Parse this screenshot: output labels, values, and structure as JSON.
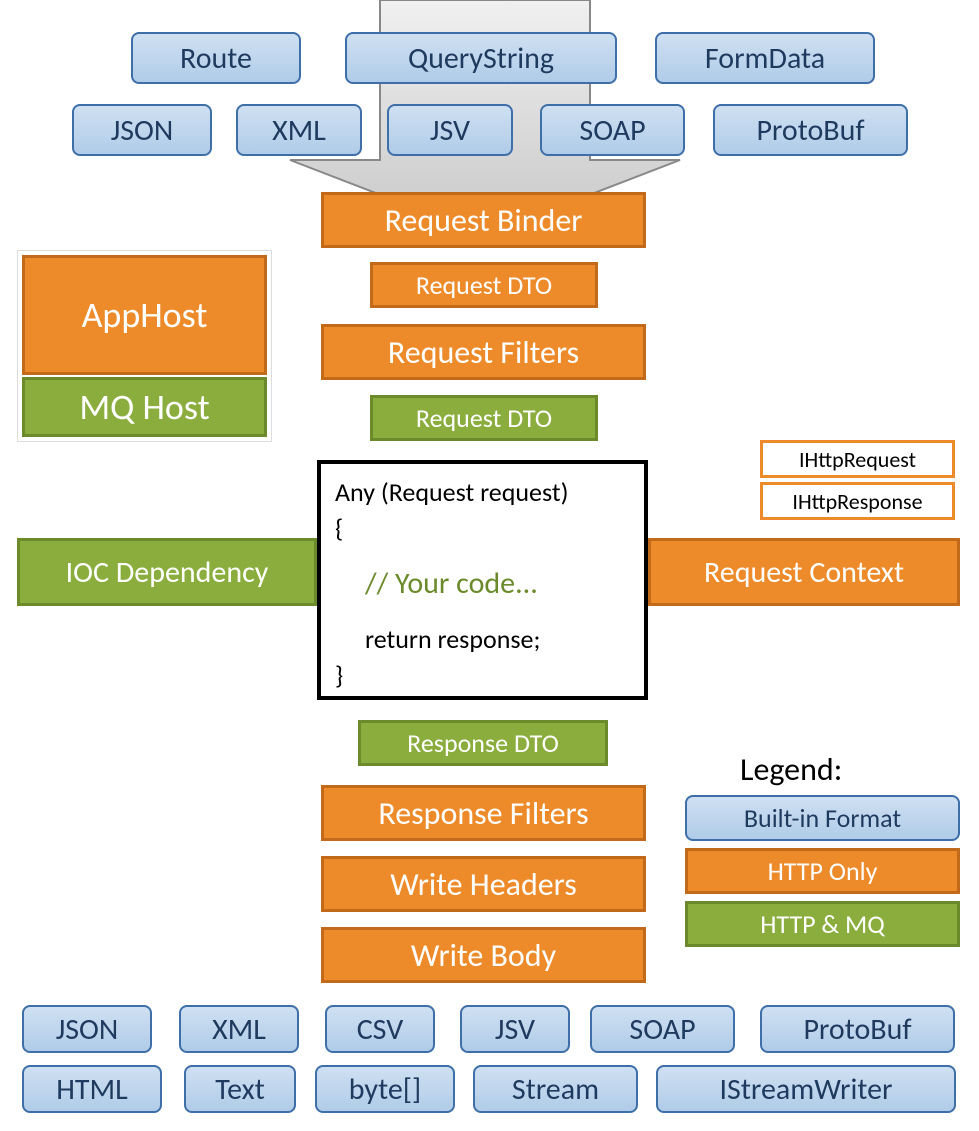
{
  "top_inputs_row1": {
    "route": "Route",
    "querystring": "QueryString",
    "formdata": "FormData"
  },
  "top_inputs_row2": {
    "json": "JSON",
    "xml": "XML",
    "jsv": "JSV",
    "soap": "SOAP",
    "protobuf": "ProtoBuf"
  },
  "pipeline": {
    "request_binder": "Request Binder",
    "request_dto_1": "Request DTO",
    "request_filters": "Request Filters",
    "request_dto_2": "Request DTO",
    "response_dto": "Response DTO",
    "response_filters": "Response Filters",
    "write_headers": "Write Headers",
    "write_body": "Write Body"
  },
  "hosts": {
    "apphost": "AppHost",
    "mqhost": "MQ Host"
  },
  "side": {
    "ioc": "IOC Dependency",
    "request_context": "Request Context",
    "ihttprequest": "IHttpRequest",
    "ihttpresponse": "IHttpResponse"
  },
  "code": {
    "line1": "Any (Request request)",
    "line2": "{",
    "comment": "// Your code...",
    "line3": "return response;",
    "line4": "}"
  },
  "legend": {
    "title": "Legend:",
    "builtin": "Built-in Format",
    "http_only": "HTTP Only",
    "http_mq": "HTTP & MQ"
  },
  "outputs_row1": {
    "json": "JSON",
    "xml": "XML",
    "csv": "CSV",
    "jsv": "JSV",
    "soap": "SOAP",
    "protobuf": "ProtoBuf"
  },
  "outputs_row2": {
    "html": "HTML",
    "text": "Text",
    "bytearr": "byte[]",
    "stream": "Stream",
    "istreamwriter": "IStreamWriter"
  }
}
